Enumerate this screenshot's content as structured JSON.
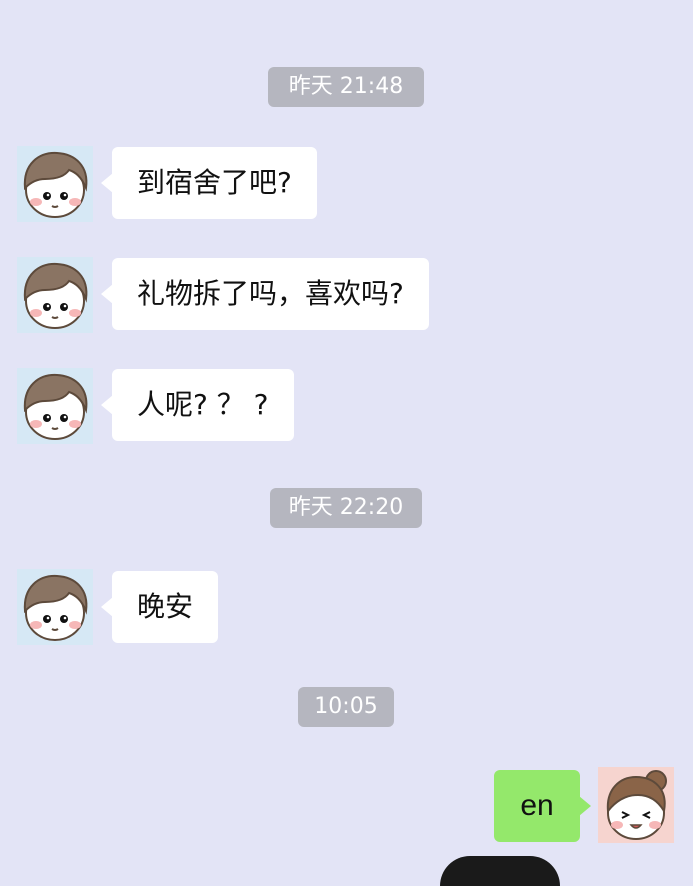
{
  "messages": [
    {
      "kind": "time",
      "text": "昨天  21:48"
    },
    {
      "kind": "left",
      "text": "到宿舍了吧?"
    },
    {
      "kind": "left",
      "text": "礼物拆了吗，喜欢吗?"
    },
    {
      "kind": "left",
      "text": "人呢? ？ ?"
    },
    {
      "kind": "time",
      "text": "昨天  22:20"
    },
    {
      "kind": "left",
      "text": "晚安"
    },
    {
      "kind": "time",
      "text": "10:05"
    },
    {
      "kind": "right",
      "text": "en"
    }
  ],
  "avatars": {
    "contact": "boy-avatar-icon",
    "self": "girl-avatar-icon"
  },
  "colors": {
    "background": "#e3e4f6",
    "timestamp_bg": "#b5b6bf",
    "incoming_bubble": "#ffffff",
    "outgoing_bubble": "#94e86b"
  }
}
